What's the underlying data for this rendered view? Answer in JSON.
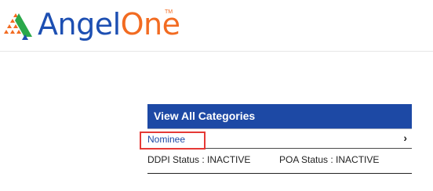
{
  "brand": {
    "name_part1": "Angel",
    "name_part2": "One",
    "trademark": "TM",
    "logo_icon": "angelone-triangle-logo-icon",
    "colors": {
      "blue": "#1d4fb2",
      "orange": "#f26b21",
      "green": "#2aa84a"
    }
  },
  "categories": {
    "header": "View All Categories",
    "nominee_label": "Nominee",
    "chevron_icon": "chevron-right-icon",
    "chevron_glyph": "›",
    "ddpi_status": "DDPI Status : INACTIVE",
    "poa_status": "POA Status : INACTIVE",
    "header_color": "#1d49a5",
    "highlight_color": "#e53935"
  }
}
